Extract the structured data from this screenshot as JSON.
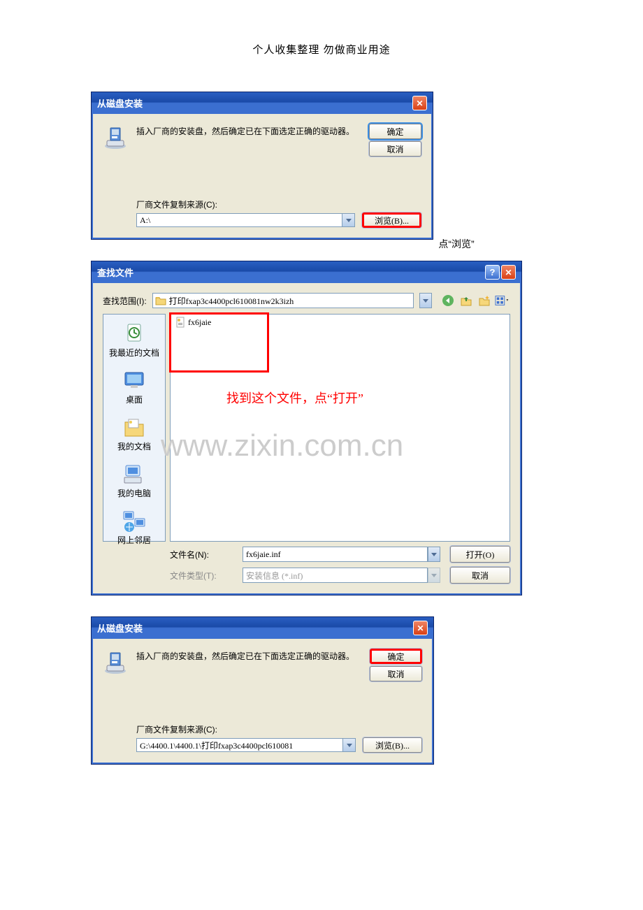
{
  "header": "个人收集整理 勿做商业用途",
  "watermark": "www.zixin.com.cn",
  "dialog1": {
    "title": "从磁盘安装",
    "instruction": "插入厂商的安装盘，然后确定已在下面选定正确的驱动器。",
    "ok": "确定",
    "cancel": "取消",
    "source_label": "厂商文件复制来源(C):",
    "source_value": "A:\\",
    "browse": "浏览(B)...",
    "note": "点“浏览”"
  },
  "dialog2": {
    "title": "查找文件",
    "look_in_label": "查找范围(I):",
    "look_in_value": "打印fxap3c4400pcl610081nw2k3izh",
    "file_item": "fx6jaie",
    "annotation": "找到这个文件，点“打开”",
    "places": {
      "recent": "我最近的文档",
      "desktop": "桌面",
      "mydocs": "我的文档",
      "mycomputer": "我的电脑",
      "network": "网上邻居"
    },
    "filename_label": "文件名(N):",
    "filename_value": "fx6jaie.inf",
    "filetype_label": "文件类型(T):",
    "filetype_value": "安装信息 (*.inf)",
    "open": "打开(O)",
    "cancel2": "取消"
  },
  "dialog3": {
    "title": "从磁盘安装",
    "instruction": "插入厂商的安装盘，然后确定已在下面选定正确的驱动器。",
    "ok": "确定",
    "cancel": "取消",
    "source_label": "厂商文件复制来源(C):",
    "source_value": "G:\\4400.1\\4400.1\\打印fxap3c4400pcl610081",
    "browse": "浏览(B)..."
  }
}
